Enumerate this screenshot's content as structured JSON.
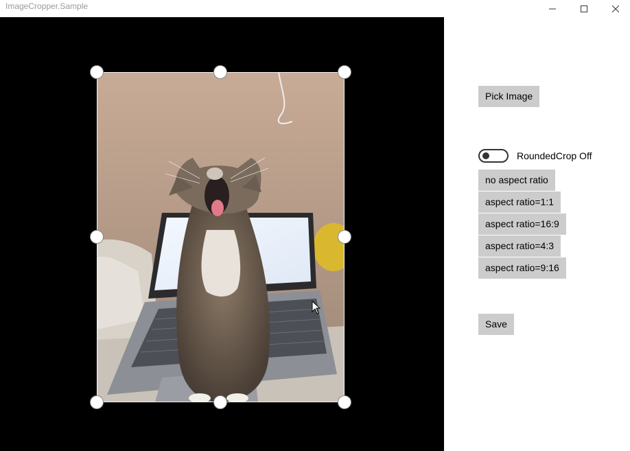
{
  "window": {
    "title": "ImageCropper.Sample"
  },
  "controls": {
    "pick_image": "Pick Image",
    "rounded_crop_label": "RoundedCrop Off",
    "rounded_crop_on": false,
    "aspect_ratios": [
      "no aspect ratio",
      "aspect ratio=1:1",
      "aspect ratio=16:9",
      "aspect ratio=4:3",
      "aspect ratio=9:16"
    ],
    "save": "Save"
  },
  "colors": {
    "canvas_bg": "#000000",
    "button_bg": "#cccccc",
    "handle": "#ffffff"
  }
}
